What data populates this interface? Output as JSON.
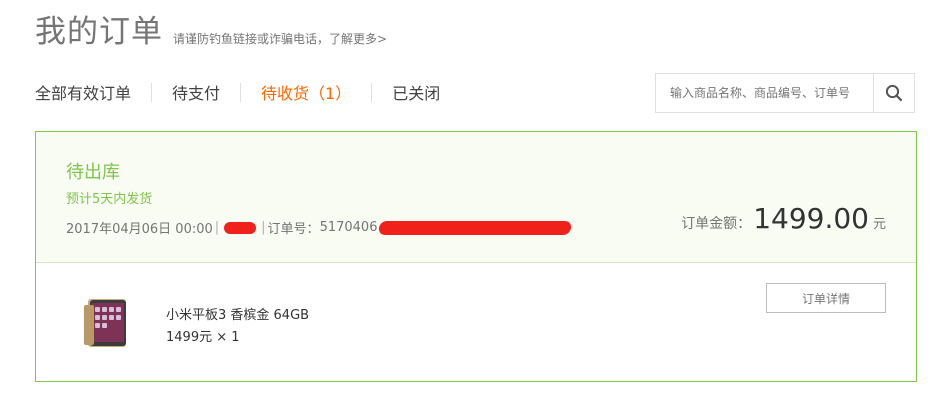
{
  "header": {
    "title": "我的订单",
    "fraud_notice": "请谨防钓鱼链接或诈骗电话，了解更多>"
  },
  "tabs": [
    {
      "label": "全部有效订单"
    },
    {
      "label": "待支付"
    },
    {
      "label": "待收货（1）",
      "active": true
    },
    {
      "label": "已关闭"
    }
  ],
  "search": {
    "placeholder": "输入商品名称、商品编号、订单号",
    "icon": "search-icon"
  },
  "order": {
    "status": "待出库",
    "description": "预计5天内发货",
    "date": "2017年04月06日 00:00",
    "order_no_label": "订单号：",
    "order_no_partial": "5170406",
    "total_label": "订单金额：",
    "total_amount": "1499.00",
    "total_unit": "元",
    "detail_button": "订单详情",
    "product": {
      "name": "小米平板3 香槟金 64GB",
      "price_qty": "1499元 × 1"
    }
  },
  "colors": {
    "accent": "#ff6700",
    "status_green": "#83c44e",
    "redaction": "#f0201a"
  }
}
